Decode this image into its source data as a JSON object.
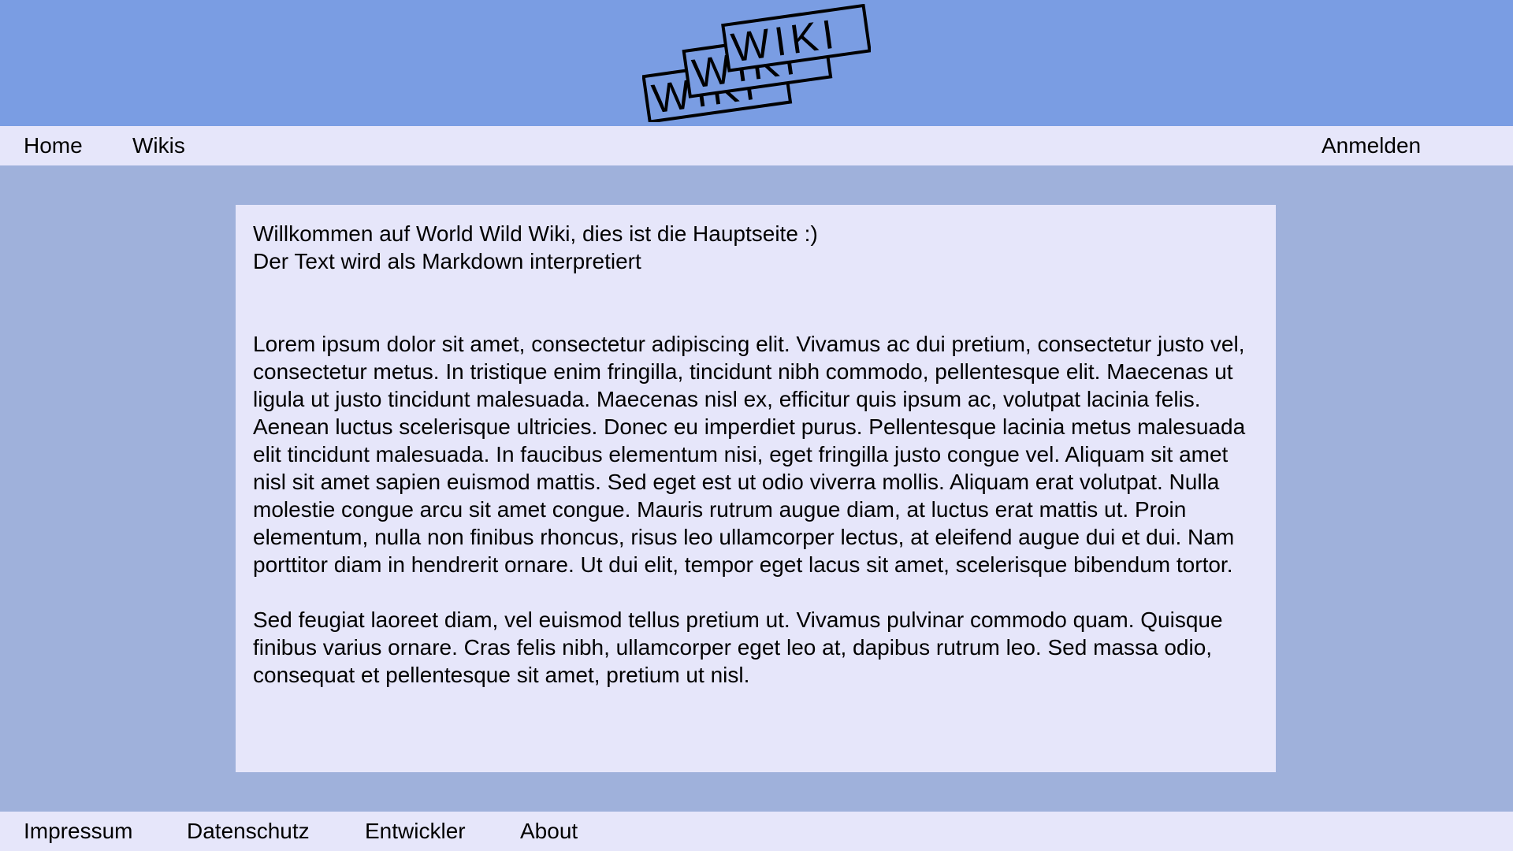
{
  "colors": {
    "header_bg": "#7a9de3",
    "page_bg": "#9fb1db",
    "bar_bg": "#e6e6fa",
    "content_bg": "#e6e6fa"
  },
  "logo": {
    "text": "WIKI"
  },
  "nav": {
    "home": "Home",
    "wikis": "Wikis",
    "login": "Anmelden"
  },
  "content": {
    "line1": "Willkommen auf World Wild Wiki, dies ist die Hauptseite :)",
    "line2": "Der Text wird als Markdown interpretiert",
    "para1": "Lorem ipsum dolor sit amet, consectetur adipiscing elit. Vivamus ac dui pretium, consectetur justo vel, consectetur metus. In tristique enim fringilla, tincidunt nibh commodo, pellentesque elit. Maecenas ut ligula ut justo tincidunt malesuada. Maecenas nisl ex, efficitur quis ipsum ac, volutpat lacinia felis. Aenean luctus scelerisque ultricies. Donec eu imperdiet purus. Pellentesque lacinia metus malesuada elit tincidunt malesuada. In faucibus elementum nisi, eget fringilla justo congue vel. Aliquam sit amet nisl sit amet sapien euismod mattis. Sed eget est ut odio viverra mollis. Aliquam erat volutpat. Nulla molestie congue arcu sit amet congue. Mauris rutrum augue diam, at luctus erat mattis ut. Proin elementum, nulla non finibus rhoncus, risus leo ullamcorper lectus, at eleifend augue dui et dui. Nam porttitor diam in hendrerit ornare. Ut dui elit, tempor eget lacus sit amet, scelerisque bibendum tortor.",
    "para2": "Sed feugiat laoreet diam, vel euismod tellus pretium ut. Vivamus pulvinar commodo quam. Quisque finibus varius ornare. Cras felis nibh, ullamcorper eget leo at, dapibus rutrum leo. Sed massa odio, consequat et pellentesque sit amet, pretium ut nisl."
  },
  "footer": {
    "impressum": "Impressum",
    "datenschutz": "Datenschutz",
    "entwickler": "Entwickler",
    "about": "About"
  }
}
